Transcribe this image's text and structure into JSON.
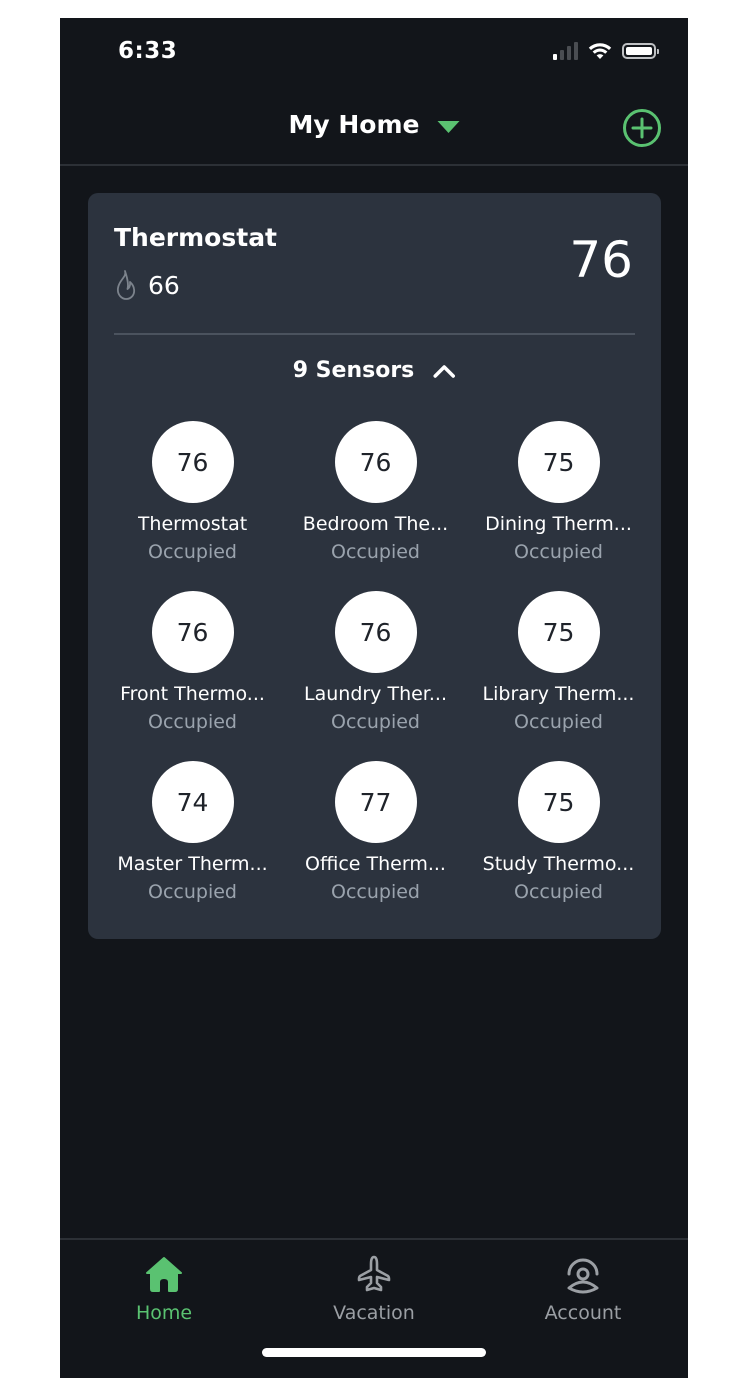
{
  "status_bar": {
    "time": "6:33",
    "signal_bars_active": 1,
    "signal_bars_total": 4,
    "wifi_icon": "wifi-icon",
    "battery_icon": "battery-icon"
  },
  "header": {
    "title": "My Home",
    "dropdown_icon": "caret-down-icon",
    "add_icon": "plus-circle-icon"
  },
  "colors": {
    "accent": "#5ac271",
    "background": "#12151a",
    "card": "#2c333e",
    "muted_text": "#9aa3ad"
  },
  "thermostat_card": {
    "title": "Thermostat",
    "heat_icon": "flame-icon",
    "heat_setpoint": "66",
    "current_temperature": "76",
    "sensors_label": "9 Sensors",
    "toggle_icon": "chevron-up-icon",
    "sensors": [
      {
        "temp": "76",
        "name": "Thermostat",
        "status": "Occupied"
      },
      {
        "temp": "76",
        "name": "Bedroom The...",
        "status": "Occupied"
      },
      {
        "temp": "75",
        "name": "Dining Therm...",
        "status": "Occupied"
      },
      {
        "temp": "76",
        "name": "Front Thermo...",
        "status": "Occupied"
      },
      {
        "temp": "76",
        "name": "Laundry Ther...",
        "status": "Occupied"
      },
      {
        "temp": "75",
        "name": "Library Therm...",
        "status": "Occupied"
      },
      {
        "temp": "74",
        "name": "Master Therm...",
        "status": "Occupied"
      },
      {
        "temp": "77",
        "name": "Office Therm...",
        "status": "Occupied"
      },
      {
        "temp": "75",
        "name": "Study Thermo...",
        "status": "Occupied"
      }
    ]
  },
  "bottom_nav": {
    "items": [
      {
        "label": "Home",
        "icon": "home-icon",
        "active": true
      },
      {
        "label": "Vacation",
        "icon": "airplane-icon",
        "active": false
      },
      {
        "label": "Account",
        "icon": "account-icon",
        "active": false
      }
    ]
  }
}
